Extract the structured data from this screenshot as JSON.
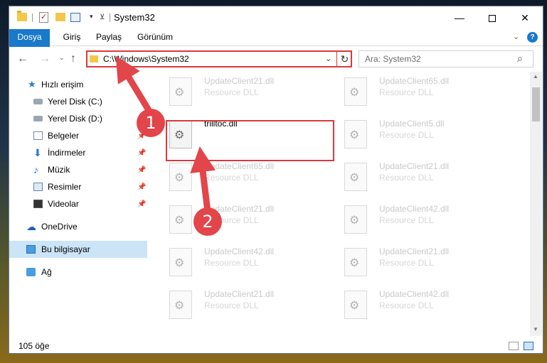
{
  "window": {
    "title": "System32",
    "minimize_glyph": "—",
    "close_glyph": "✕"
  },
  "ribbon": {
    "tabs": [
      "Dosya",
      "Giriş",
      "Paylaş",
      "Görünüm"
    ],
    "chevron": "⌄",
    "help": "?"
  },
  "nav": {
    "back": "←",
    "forward": "→",
    "recent": "⌄",
    "up": "↑",
    "address": "C:\\Windows\\System32",
    "address_dropdown": "⌄",
    "refresh": "↻",
    "search_placeholder": "Ara: System32",
    "search_icon": "⌕"
  },
  "sidebar": {
    "items": [
      {
        "label": "Hızlı erişim",
        "icon": "star-icon"
      },
      {
        "label": "Yerel Disk (C:)",
        "icon": "drive-icon"
      },
      {
        "label": "Yerel Disk (D:)",
        "icon": "drive-icon"
      },
      {
        "label": "Belgeler",
        "icon": "documents-icon",
        "pinned": true
      },
      {
        "label": "İndirmeler",
        "icon": "downloads-icon",
        "pinned": true
      },
      {
        "label": "Müzik",
        "icon": "music-icon",
        "pinned": true
      },
      {
        "label": "Resimler",
        "icon": "pictures-icon",
        "pinned": true
      },
      {
        "label": "Videolar",
        "icon": "videos-icon",
        "pinned": true
      },
      {
        "label": "OneDrive",
        "icon": "onedrive-icon"
      },
      {
        "label": "Bu bilgisayar",
        "icon": "computer-icon",
        "selected": true
      },
      {
        "label": "Ağ",
        "icon": "network-icon"
      }
    ],
    "pin_glyph": "📌"
  },
  "files": [
    {
      "name": "UpdateClient21.dll",
      "desc": "Resource DLL"
    },
    {
      "name": "UpdateClient65.dll",
      "desc": "Resource DLL"
    },
    {
      "name": "trilltoc.dll",
      "desc": "",
      "highlighted": true
    },
    {
      "name": "UpdateClient5.dll",
      "desc": "Resource DLL"
    },
    {
      "name": "UpdateClient65.dll",
      "desc": "Resource DLL"
    },
    {
      "name": "UpdateClient21.dll",
      "desc": "Resource DLL"
    },
    {
      "name": "UpdateClient21.dll",
      "desc": "Resource DLL"
    },
    {
      "name": "UpdateClient42.dll",
      "desc": "Resource DLL"
    },
    {
      "name": "UpdateClient42.dll",
      "desc": "Resource DLL"
    },
    {
      "name": "UpdateClient21.dll",
      "desc": "Resource DLL"
    },
    {
      "name": "UpdateClient21.dll",
      "desc": "Resource DLL"
    },
    {
      "name": "UpdateClient42.dll",
      "desc": "Resource DLL"
    }
  ],
  "status": {
    "count": "105 öğe"
  },
  "annotations": {
    "badge1": "1",
    "badge2": "2",
    "color": "#e2454a"
  },
  "colors": {
    "accent": "#1979ca",
    "highlight_box": "#d9393e",
    "selection": "#cce4f7"
  }
}
